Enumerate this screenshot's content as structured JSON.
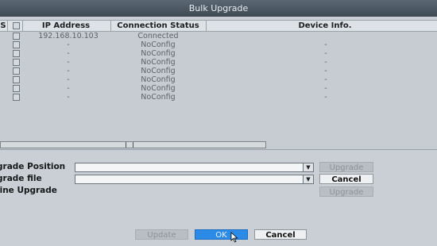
{
  "window": {
    "title": "Bulk Upgrade"
  },
  "table": {
    "headers": {
      "s": "S",
      "ip": "IP Address",
      "status": "Connection Status",
      "info": "Device Info."
    },
    "rows": [
      {
        "ip": "192.168.10.103",
        "status": "Connected",
        "info": ""
      },
      {
        "ip": "-",
        "status": "NoConfig",
        "info": "-"
      },
      {
        "ip": "-",
        "status": "NoConfig",
        "info": "-"
      },
      {
        "ip": "-",
        "status": "NoConfig",
        "info": "-"
      },
      {
        "ip": "-",
        "status": "NoConfig",
        "info": "-"
      },
      {
        "ip": "-",
        "status": "NoConfig",
        "info": "-"
      },
      {
        "ip": "-",
        "status": "NoConfig",
        "info": "-"
      },
      {
        "ip": "-",
        "status": "NoConfig",
        "info": "-"
      }
    ]
  },
  "form": {
    "position_label": "grade Position",
    "file_label": "grade file",
    "online_label": "line Upgrade",
    "position_value": "",
    "file_value": "",
    "upgrade_label": "Upgrade",
    "cancel_label": "Cancel",
    "online_upgrade_label": "Upgrade"
  },
  "footer": {
    "update_label": "Update",
    "ok_label": "OK",
    "cancel_label": "Cancel"
  },
  "colors": {
    "accent": "#2c8be6",
    "titlebar": "#4a5661"
  }
}
